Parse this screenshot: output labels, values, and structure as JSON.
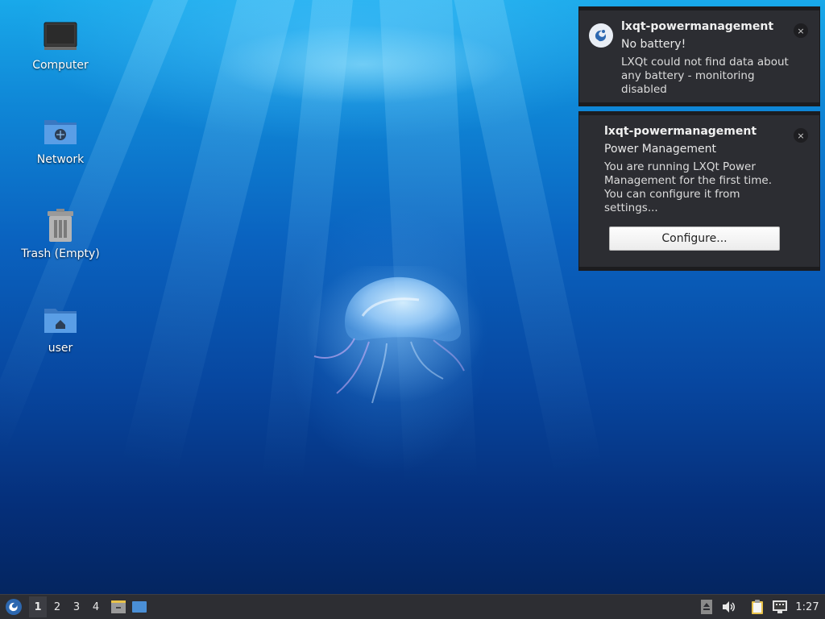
{
  "desktop": {
    "icons": [
      {
        "name": "computer",
        "label": "Computer"
      },
      {
        "name": "network",
        "label": "Network"
      },
      {
        "name": "trash",
        "label": "Trash (Empty)"
      },
      {
        "name": "home",
        "label": "user"
      }
    ]
  },
  "notifications": [
    {
      "app": "lxqt-powermanagement",
      "summary": "No battery!",
      "body": "LXQt could not find data about any battery - monitoring disabled",
      "close_glyph": "×"
    },
    {
      "app": "lxqt-powermanagement",
      "summary": "Power Management",
      "body": "You are running LXQt Power Management for the first time. You can configure it from settings...",
      "button": "Configure...",
      "close_glyph": "×"
    }
  ],
  "taskbar": {
    "workspaces": [
      "1",
      "2",
      "3",
      "4"
    ],
    "active_workspace": "1",
    "clock": "1:27"
  },
  "colors": {
    "panel": "#2d2e33",
    "notification_bg": "#2c2d32",
    "folder_blue": "#4a8fd6"
  }
}
